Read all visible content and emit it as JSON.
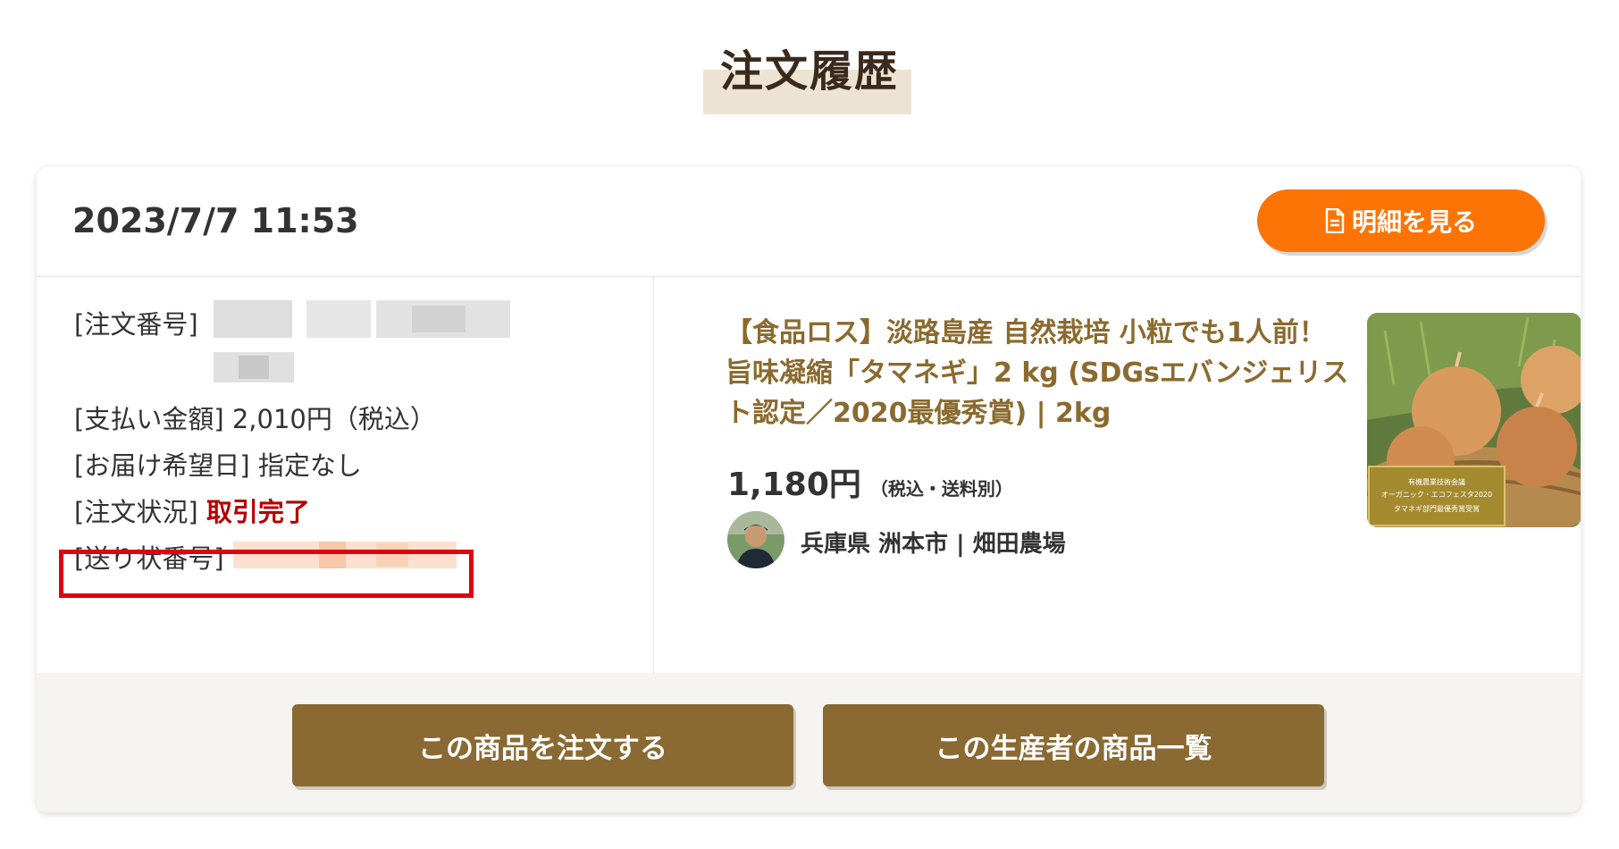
{
  "page": {
    "title": "注文履歴"
  },
  "order": {
    "datetime": "2023/7/7 11:53",
    "detail_button_label": "明細を見る",
    "order_number_label": "[注文番号]",
    "payment_label": "[支払い金額]",
    "payment_value": "2,010円（税込）",
    "delivery_label": "[お届け希望日]",
    "delivery_value": "指定なし",
    "status_label": "[注文状況]",
    "status_value": "取引完了",
    "tracking_label": "[送り状番号]"
  },
  "product": {
    "name": "【食品ロス】淡路島産 自然栽培 小粒でも1人前！旨味凝縮「タマネギ」2 kg (SDGsエバンジェリスト認定／2020最優秀賞) | 2kg",
    "price": "1,180円",
    "price_note": "（税込・送料別）",
    "producer": "兵庫県 洲本市 | 畑田農場",
    "image_badge": {
      "line1": "有機農業技術会議",
      "line2": "オーガニック・エコフェスタ2020",
      "line3": "タマネギ部門最優秀賞受賞"
    }
  },
  "footer": {
    "order_again_label": "この商品を注文する",
    "producer_items_label": "この生産者の商品一覧"
  },
  "colors": {
    "accent_orange": "#fc7405",
    "brand_brown": "#8a6a32",
    "status_red": "#b40000",
    "highlight_red": "#e00012"
  }
}
